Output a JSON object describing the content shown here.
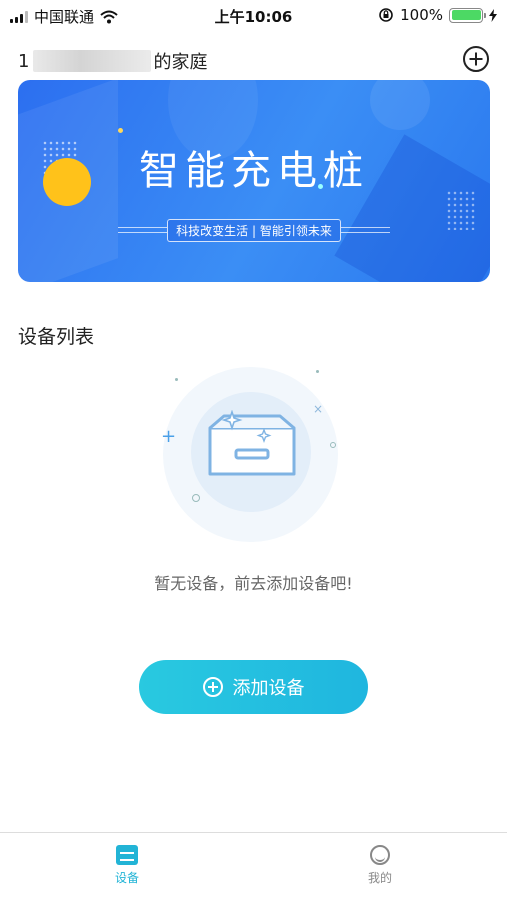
{
  "status_bar": {
    "carrier": "中国联通",
    "time": "上午10:06",
    "battery": "100%",
    "battery_level": 1.0,
    "wifi_icon": "wifi-icon",
    "lock_icon": "orientation-lock-icon",
    "charging_icon": "charging-bolt-icon"
  },
  "header": {
    "home_prefix": "1",
    "home_suffix": "的家庭",
    "add_icon": "plus-circle-icon"
  },
  "banner": {
    "title": "智能充电桩",
    "subtitle": "科技改变生活 | 智能引领未来",
    "colors": {
      "background": "#3b8ef5",
      "sun": "#ffc21a"
    }
  },
  "devices": {
    "section_title": "设备列表",
    "empty_text": "暂无设备，前去添加设备吧!",
    "empty_icon": "empty-box-icon",
    "add_button_label": "添加设备",
    "add_button_icon": "plus-circle-icon",
    "accent": "#22b4d6"
  },
  "tabbar": {
    "tabs": [
      {
        "label": "设备",
        "icon": "devices-icon",
        "active": true
      },
      {
        "label": "我的",
        "icon": "profile-icon",
        "active": false
      }
    ]
  }
}
